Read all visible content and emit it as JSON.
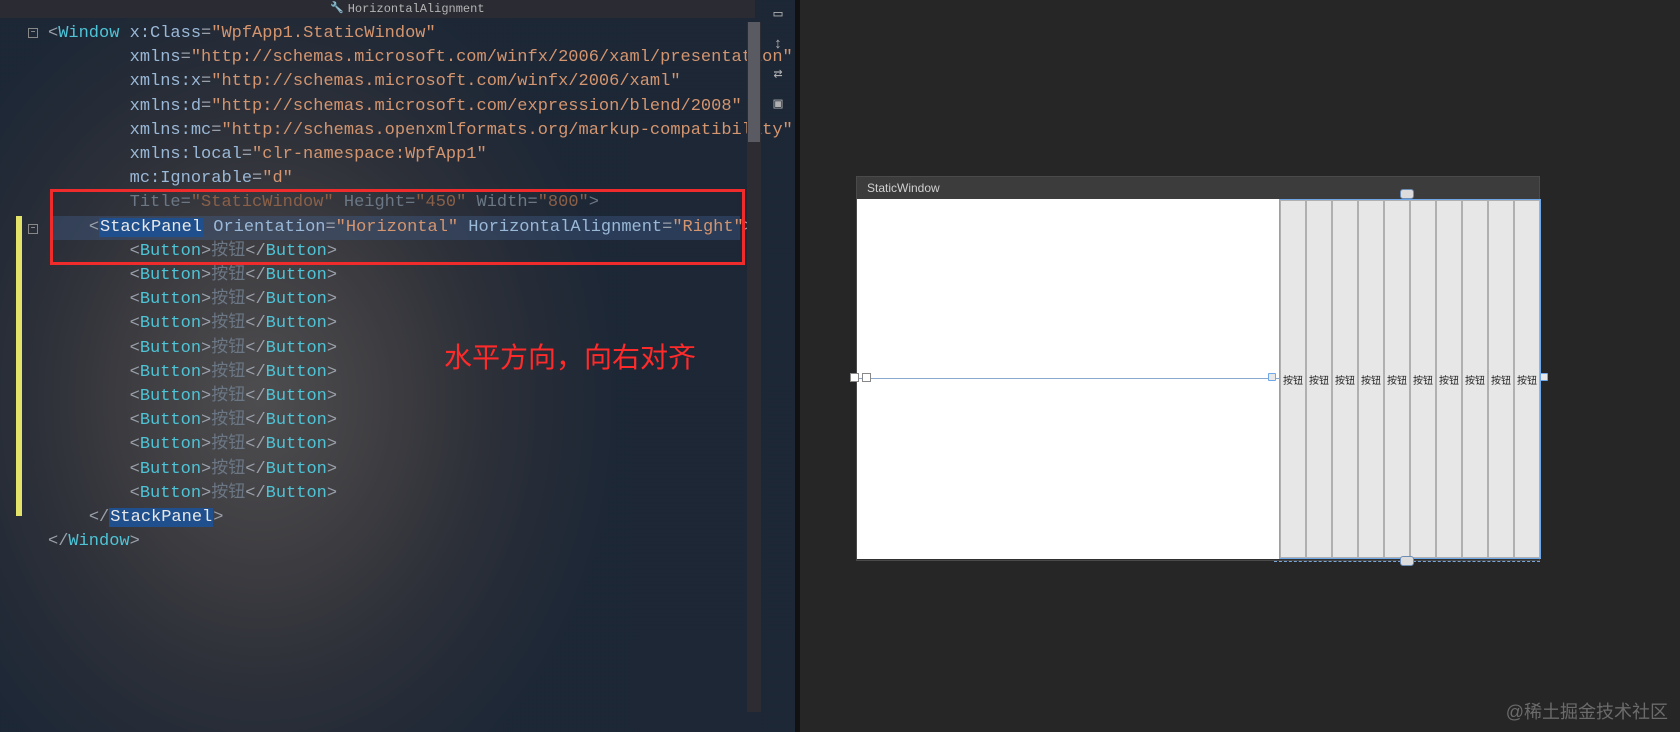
{
  "breadcrumb": {
    "label": "HorizontalAlignment"
  },
  "code": {
    "window_elem": "Window",
    "x_class_attr": "x:Class",
    "x_class_val": "\"WpfApp1.StaticWindow\"",
    "xmlns_attr": "xmlns",
    "xmlns_val": "\"http://schemas.microsoft.com/winfx/2006/xaml/presentation\"",
    "xmlns_x_attr": "xmlns:x",
    "xmlns_x_val": "\"http://schemas.microsoft.com/winfx/2006/xaml\"",
    "xmlns_d_attr": "xmlns:d",
    "xmlns_d_val": "\"http://schemas.microsoft.com/expression/blend/2008\"",
    "xmlns_mc_attr": "xmlns:mc",
    "xmlns_mc_val": "\"http://schemas.openxmlformats.org/markup-compatibility\"",
    "xmlns_local_attr": "xmlns:local",
    "xmlns_local_val": "\"clr-namespace:WpfApp1\"",
    "mc_ign_attr": "mc:Ignorable",
    "mc_ign_val": "\"d\"",
    "title_attr": "Title",
    "title_val": "\"StaticWindow\"",
    "height_attr": "Height",
    "height_val": "\"450\"",
    "width_attr": "Width",
    "width_val": "\"800\"",
    "stackpanel_elem": "StackPanel",
    "orient_attr": "Orientation",
    "orient_val": "\"Horizontal\"",
    "halign_attr": "HorizontalAlignment",
    "halign_val": "\"Right\"",
    "button_elem": "Button",
    "button_text": "按钮",
    "button_count": 11
  },
  "annotation": {
    "text": "水平方向，向右对齐"
  },
  "designer": {
    "window_title": "StaticWindow",
    "button_label": "按钮",
    "button_count": 10
  },
  "watermark": {
    "text": "@稀土掘金技术社区"
  }
}
